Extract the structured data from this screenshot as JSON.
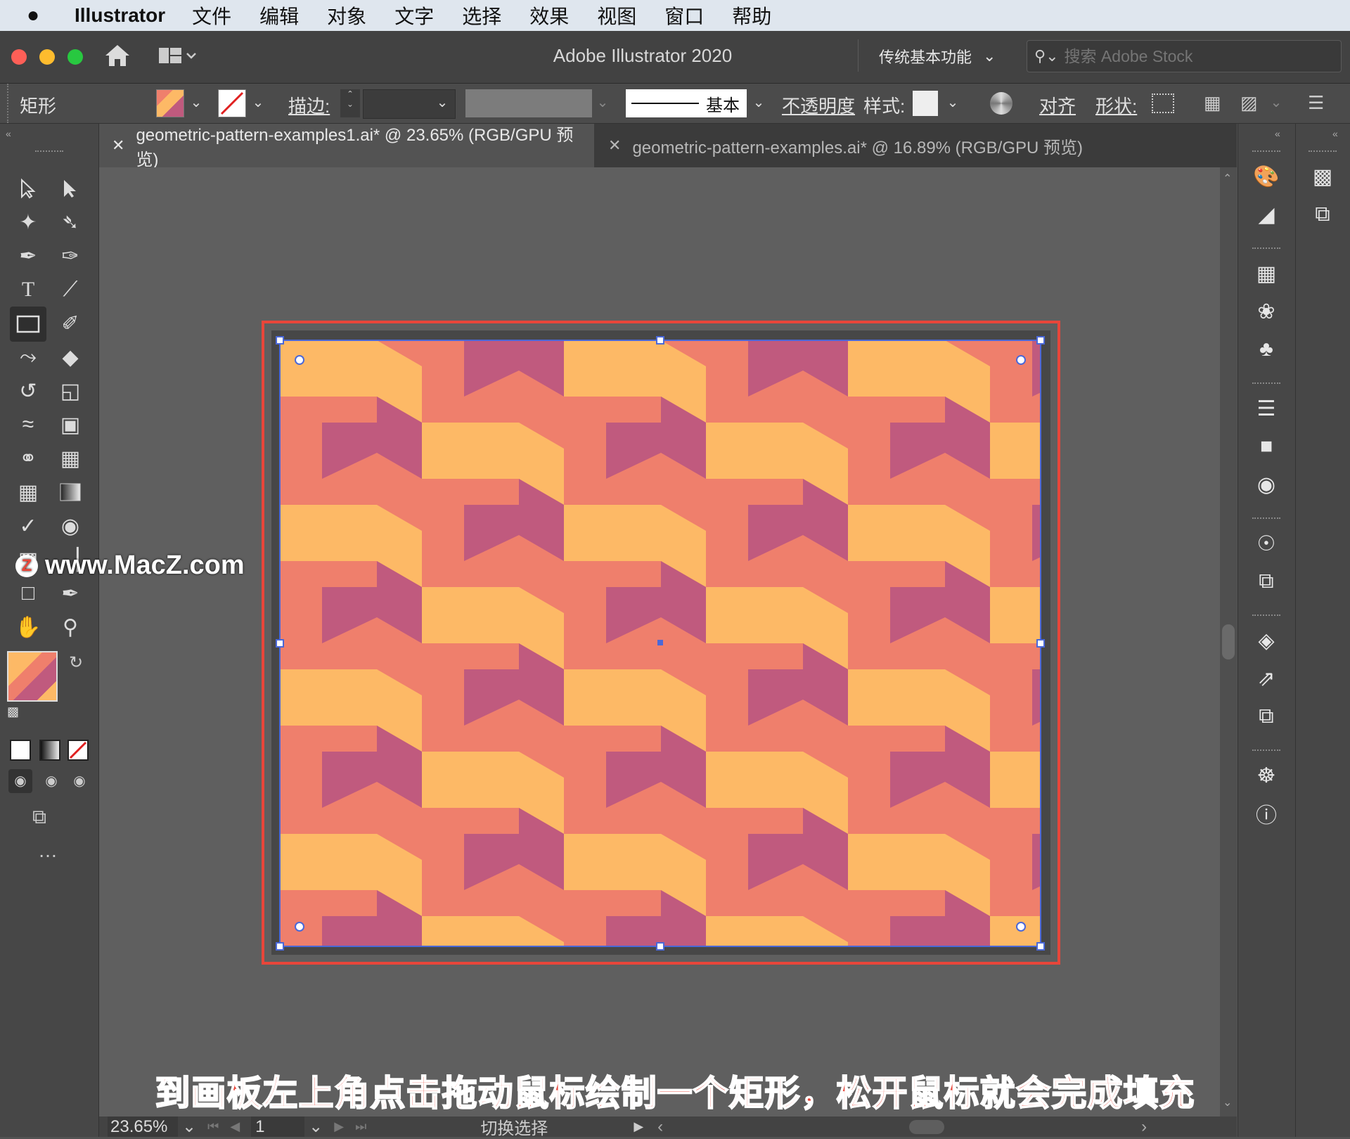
{
  "menubar": {
    "apple": "",
    "app": "Illustrator",
    "items": [
      "文件",
      "编辑",
      "对象",
      "文字",
      "选择",
      "效果",
      "视图",
      "窗口",
      "帮助"
    ]
  },
  "titlebar": {
    "title": "Adobe Illustrator 2020",
    "workspace": "传统基本功能",
    "stock_placeholder": "搜索 Adobe Stock"
  },
  "controlbar": {
    "tool_name": "矩形",
    "stroke_label": "描边:",
    "brush_style": "基本",
    "opacity_label": "不透明度",
    "style_label": "样式:",
    "align_label": "对齐",
    "shape_label": "形状:"
  },
  "tabs": [
    {
      "label": "geometric-pattern-examples1.ai* @ 23.65% (RGB/GPU 预览)",
      "active": true
    },
    {
      "label": "geometric-pattern-examples.ai* @ 16.89% (RGB/GPU 预览)",
      "active": false
    }
  ],
  "status": {
    "zoom": "23.65%",
    "page": "1",
    "toggle_label": "切换选择"
  },
  "watermark": "www.MacZ.com",
  "caption": "到画板左上角点击拖动鼠标绘制一个矩形，松开鼠标就会完成填充",
  "colors": {
    "pattern_orange": "#fdb966",
    "pattern_salmon": "#ef7f6c",
    "pattern_plum": "#c05a7e",
    "highlight_red": "#e8463a",
    "selection_blue": "#4a68d8"
  }
}
